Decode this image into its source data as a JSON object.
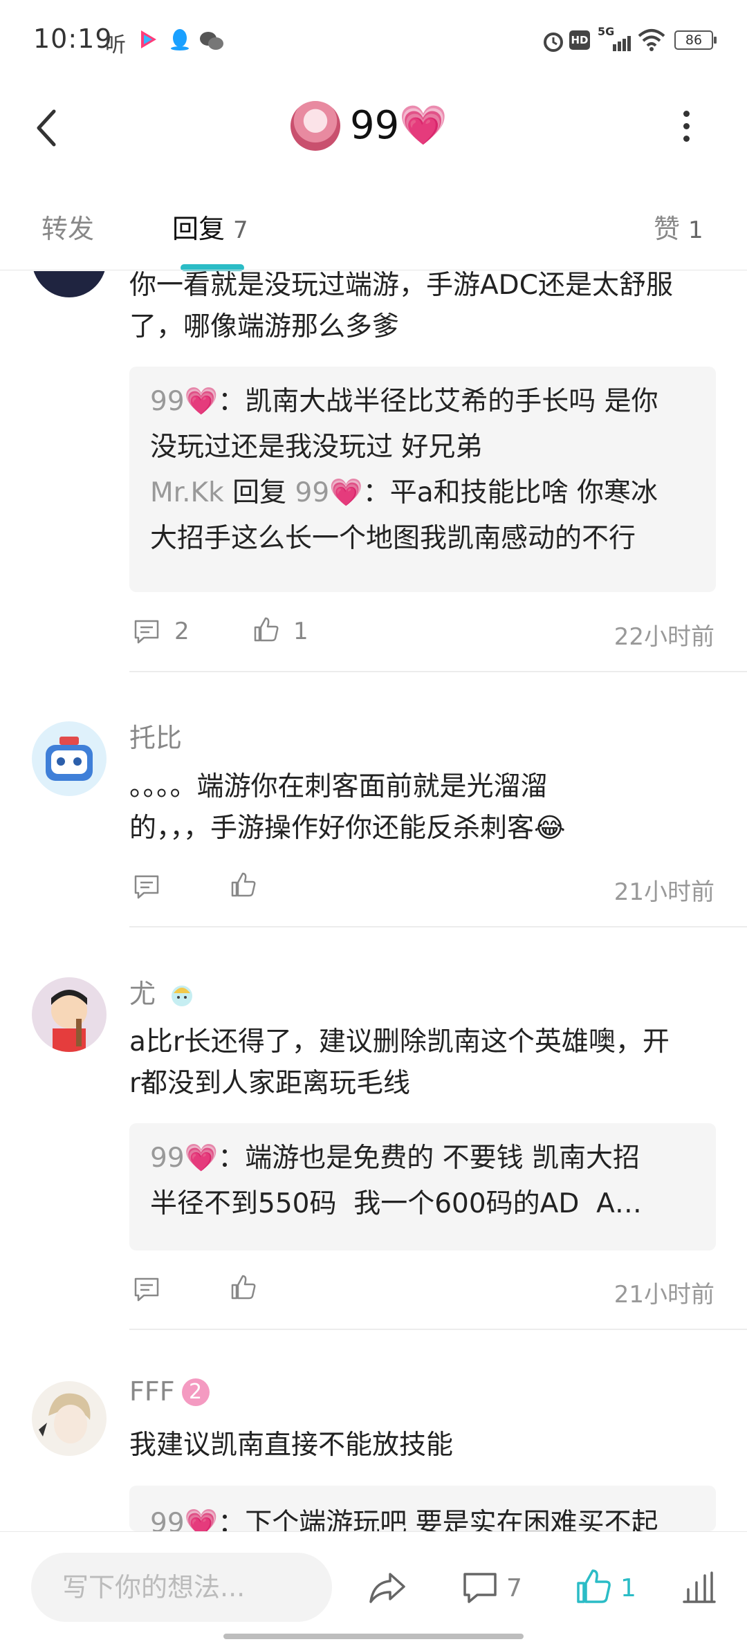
{
  "status_bar": {
    "time": "10:19",
    "listen_label": "听",
    "network_label": "5G",
    "battery": "86"
  },
  "header": {
    "title": "99",
    "heart": "💗"
  },
  "tabs": [
    {
      "label": "转发"
    },
    {
      "label": "回复",
      "count": "7"
    },
    {
      "label": "赞",
      "count": "1"
    }
  ],
  "comments": [
    {
      "text_lines": [
        "你一看就是没玩过端游，手游ADC还是太舒服",
        "了，哪像端游那么多爹"
      ],
      "replies": [
        {
          "name": "99💗",
          "sep": "：",
          "lines": [
            "凯南大战半径比艾希的手长吗 是你",
            "没玩过还是我没玩过 好兄弟"
          ]
        },
        {
          "name": "Mr.Kk",
          "reply_word": "回复",
          "target": "99💗",
          "sep": "：",
          "lines": [
            "平a和技能比啥 你寒冰",
            "大招手这么长一个地图我凯南感动的不行"
          ]
        }
      ],
      "reply_count": "2",
      "like_count": "1",
      "time": "22小时前"
    },
    {
      "name": "托比",
      "text_lines": [
        "。。。。端游你在刺客面前就是光溜溜",
        "的，，，手游操作好你还能反杀刺客😂"
      ],
      "time": "21小时前"
    },
    {
      "name": "尤",
      "text_lines": [
        "a比r长还得了，建议删除凯南这个英雄噢，开",
        "r都没到人家距离玩毛线"
      ],
      "replies": [
        {
          "name": "99💗",
          "sep": "：",
          "lines": [
            "端游也是免费的 不要钱 凯南大招",
            "半径不到550码  我一个600码的AD  A…"
          ]
        }
      ],
      "time": "21小时前"
    },
    {
      "name": "FFF",
      "badge": "2",
      "text_lines": [
        "我建议凯南直接不能放技能"
      ],
      "replies": [
        {
          "name": "99💗",
          "sep": "：",
          "lines": [
            "下个端游玩吧 要是实在困难买不起"
          ]
        }
      ]
    }
  ],
  "bottom_bar": {
    "placeholder": "写下你的想法...",
    "comment_count": "7",
    "like_count": "1"
  },
  "colors": {
    "accent": "#2bbcc6",
    "heart": "#ff4f87",
    "quote_bg": "#f5f5f5"
  }
}
